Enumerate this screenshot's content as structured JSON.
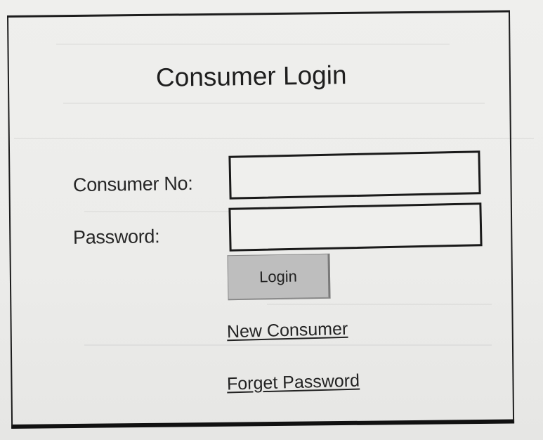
{
  "login": {
    "title": "Consumer Login",
    "consumer_no_label": "Consumer No:",
    "consumer_no_value": "",
    "password_label": "Password:",
    "password_value": "",
    "login_button": "Login",
    "new_consumer_link": "New Consumer",
    "forget_password_link": "Forget Password"
  }
}
